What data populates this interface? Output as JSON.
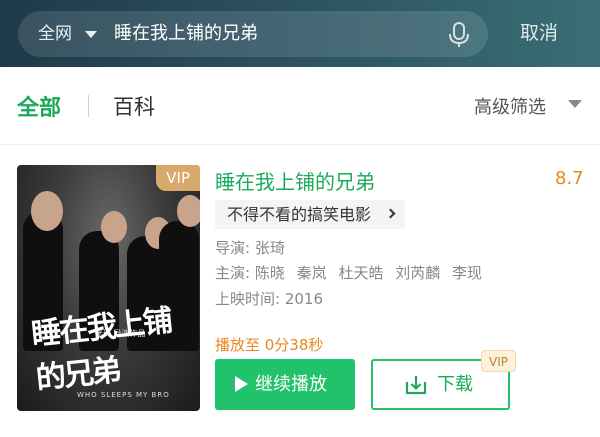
{
  "header": {
    "scope_label": "全网",
    "query": "睡在我上铺的兄弟",
    "cancel_label": "取消"
  },
  "tabs": {
    "all_label": "全部",
    "baike_label": "百科",
    "advanced_filter_label": "高级筛选"
  },
  "result": {
    "title": "睡在我上铺的兄弟",
    "score": "8.7",
    "vip_badge": "VIP",
    "poster_title": "睡在我上铺的兄弟",
    "poster_subtitle": "WHO SLEEPS MY BRO",
    "poster_maker": "张琦 导演作品",
    "tag": "不得不看的搞笑电影",
    "director_label": "导演:",
    "director": "张琦",
    "cast_label": "主演:",
    "cast": [
      "陈晓",
      "秦岚",
      "杜天皓",
      "刘芮麟",
      "李现"
    ],
    "release_label": "上映时间:",
    "release_year": "2016",
    "progress_text": "播放至 0分38秒",
    "play_button_label": "继续播放",
    "download_button_label": "下载",
    "download_vip_label": "VIP"
  },
  "colors": {
    "accent_green": "#1aab5a",
    "orange": "#e8871e",
    "header_dark": "#1f3a4a"
  }
}
